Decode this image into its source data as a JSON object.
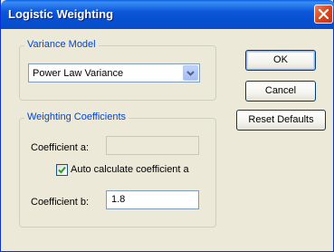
{
  "window": {
    "title": "Logistic Weighting"
  },
  "variance_model": {
    "group_label": "Variance Model",
    "selected": "Power Law Variance"
  },
  "weighting": {
    "group_label": "Weighting Coefficients",
    "coef_a_label": "Coefficient a:",
    "coef_a_value": "",
    "auto_calc_label": "Auto calculate coefficient a",
    "auto_calc_checked": true,
    "coef_b_label": "Coefficient b:",
    "coef_b_value": "1.8"
  },
  "buttons": {
    "ok": "OK",
    "cancel": "Cancel",
    "reset": "Reset Defaults"
  },
  "colors": {
    "titlebar": "#0550D0",
    "group_label": "#0046D5",
    "close": "#D7431B"
  }
}
